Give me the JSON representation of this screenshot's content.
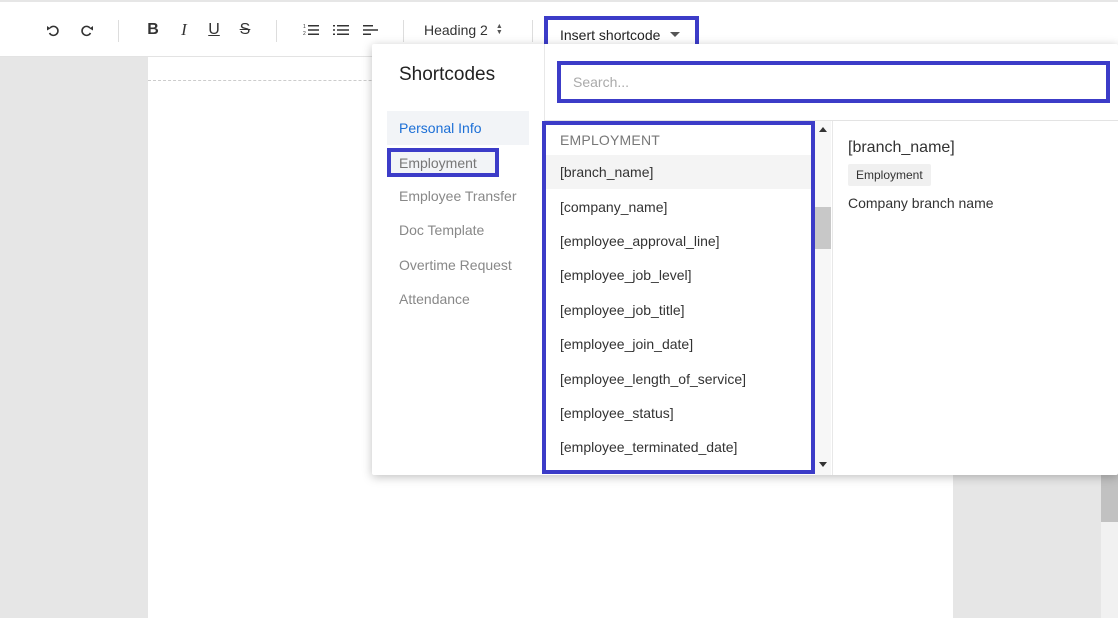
{
  "toolbar": {
    "heading_value": "Heading 2",
    "insert_label": "Insert shortcode"
  },
  "popup": {
    "title": "Shortcodes",
    "search_placeholder": "Search...",
    "categories": [
      "Personal Info",
      "Employment",
      "Employee Transfer",
      "Doc Template",
      "Overtime Request",
      "Attendance"
    ],
    "active_category": "Personal Info",
    "highlighted_category": "Employment",
    "list_header": "EMPLOYMENT",
    "items": [
      "[branch_name]",
      "[company_name]",
      "[employee_approval_line]",
      "[employee_job_level]",
      "[employee_job_title]",
      "[employee_join_date]",
      "[employee_length_of_service]",
      "[employee_status]",
      "[employee_terminated_date]"
    ],
    "detail": {
      "title": "[branch_name]",
      "badge": "Employment",
      "description": "Company branch name"
    }
  },
  "colors": {
    "highlight": "#3c3cc8",
    "active_link": "#1c6fd6"
  }
}
